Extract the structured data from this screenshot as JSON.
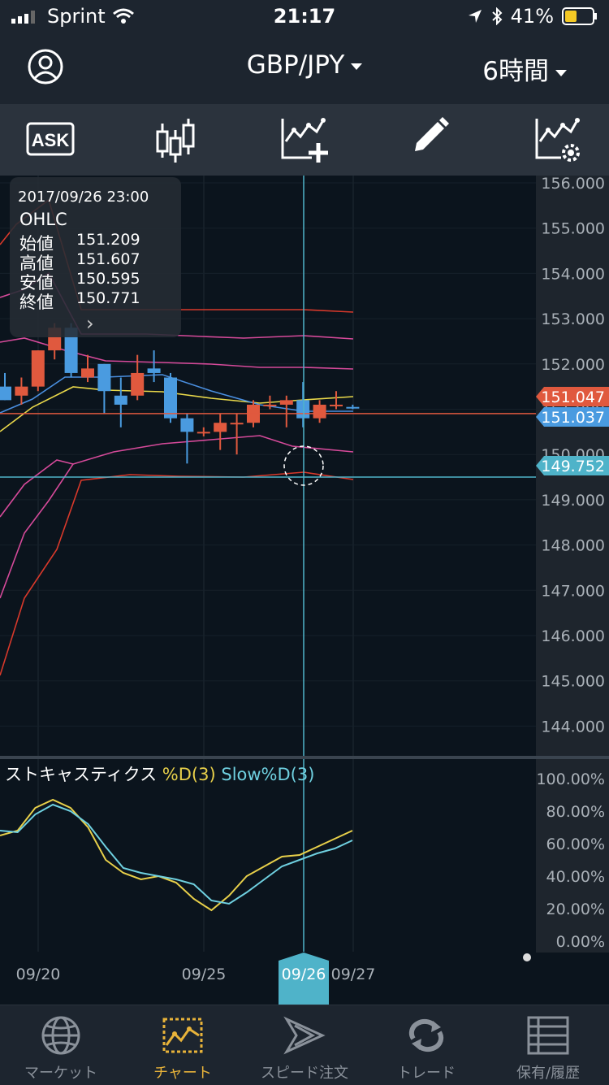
{
  "status_bar": {
    "carrier": "Sprint",
    "time": "21:17",
    "battery": "41%"
  },
  "nav": {
    "pair": "GBP/JPY",
    "timeframe": "6時間"
  },
  "toolbar": {
    "ask_label": "ASK"
  },
  "tooltip": {
    "datetime": "2017/09/26 23:00",
    "label": "OHLC",
    "open_key": "始値",
    "open": "151.209",
    "high_key": "高値",
    "high": "151.607",
    "low_key": "安値",
    "low": "150.595",
    "close_key": "終値",
    "close": "150.771"
  },
  "price_axis": [
    "156.000",
    "155.000",
    "154.000",
    "153.000",
    "152.000",
    "151.000",
    "150.000",
    "149.000",
    "148.000",
    "147.000",
    "146.000",
    "145.000",
    "144.000"
  ],
  "price_markers": {
    "ask": "151.047",
    "bid": "151.037",
    "crosshair": "149.752"
  },
  "indicator": {
    "name": "ストキャスティクス",
    "d_label": "%D(3)",
    "slow_label": "Slow%D(3)"
  },
  "indicator_axis": [
    "100.00%",
    "80.00%",
    "60.00%",
    "40.00%",
    "20.00%",
    "0.00%"
  ],
  "date_axis": [
    "09/20",
    "09/25",
    "09/26",
    "09/27"
  ],
  "tabs": [
    {
      "label": "マーケット"
    },
    {
      "label": "チャート"
    },
    {
      "label": "スピード注文"
    },
    {
      "label": "トレード"
    },
    {
      "label": "保有/履歴"
    }
  ],
  "colors": {
    "up": "#e0593e",
    "down": "#4a9be0",
    "accent": "#e8b33a",
    "cross": "#4fb3c9"
  },
  "chart_data": {
    "type": "candlestick",
    "timeframe": "6時間",
    "ylim": [
      143.5,
      156.2
    ],
    "candles": [
      {
        "o": 151.5,
        "h": 151.8,
        "l": 151.2,
        "c": 151.2
      },
      {
        "o": 151.3,
        "h": 151.7,
        "l": 151.1,
        "c": 151.5
      },
      {
        "o": 151.5,
        "h": 152.3,
        "l": 151.4,
        "c": 152.3
      },
      {
        "o": 152.3,
        "h": 152.9,
        "l": 152.1,
        "c": 152.8
      },
      {
        "o": 152.8,
        "h": 152.9,
        "l": 151.7,
        "c": 151.8
      },
      {
        "o": 151.7,
        "h": 152.2,
        "l": 151.6,
        "c": 151.9
      },
      {
        "o": 152.0,
        "h": 152.0,
        "l": 150.9,
        "c": 151.4
      },
      {
        "o": 151.3,
        "h": 151.7,
        "l": 150.6,
        "c": 151.1
      },
      {
        "o": 151.3,
        "h": 152.2,
        "l": 151.2,
        "c": 151.8
      },
      {
        "o": 151.9,
        "h": 152.3,
        "l": 151.6,
        "c": 151.8
      },
      {
        "o": 151.7,
        "h": 151.8,
        "l": 150.7,
        "c": 150.8
      },
      {
        "o": 150.8,
        "h": 150.9,
        "l": 149.8,
        "c": 150.5
      },
      {
        "o": 150.5,
        "h": 150.6,
        "l": 150.4,
        "c": 150.5
      },
      {
        "o": 150.5,
        "h": 150.9,
        "l": 150.1,
        "c": 150.7
      },
      {
        "o": 150.7,
        "h": 150.9,
        "l": 150.0,
        "c": 150.7
      },
      {
        "o": 150.7,
        "h": 151.2,
        "l": 150.6,
        "c": 151.1
      },
      {
        "o": 151.1,
        "h": 151.3,
        "l": 151.0,
        "c": 151.1
      },
      {
        "o": 151.1,
        "h": 151.3,
        "l": 150.6,
        "c": 151.2
      },
      {
        "o": 151.2,
        "h": 151.6,
        "l": 150.6,
        "c": 150.8
      },
      {
        "o": 150.8,
        "h": 151.2,
        "l": 150.7,
        "c": 151.1
      },
      {
        "o": 151.1,
        "h": 151.4,
        "l": 151.0,
        "c": 151.1
      },
      {
        "o": 151.05,
        "h": 151.1,
        "l": 151.0,
        "c": 151.04
      }
    ],
    "stochastic_d": [
      65,
      68,
      82,
      87,
      82,
      70,
      50,
      42,
      38,
      40,
      36,
      26,
      19,
      28,
      40,
      46,
      52,
      53,
      58,
      63,
      68
    ],
    "slow_d": [
      68,
      67,
      78,
      84,
      80,
      72,
      58,
      45,
      42,
      40,
      38,
      35,
      25,
      23,
      30,
      38,
      46,
      50,
      54,
      57,
      62
    ]
  }
}
